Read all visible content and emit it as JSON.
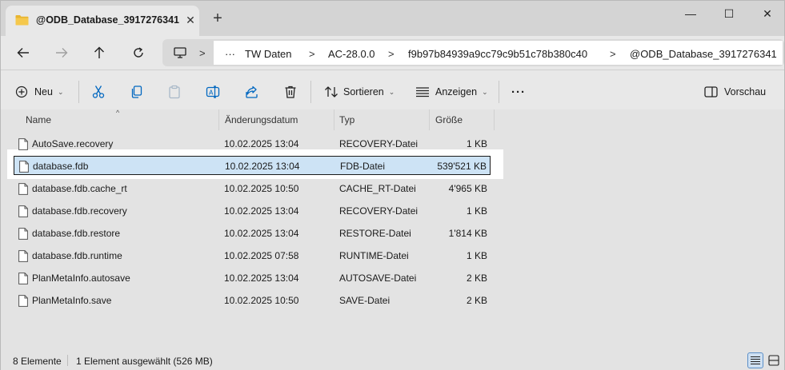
{
  "window": {
    "tab_title": "@ODB_Database_3917276341",
    "close_tab_glyph": "✕",
    "new_tab_glyph": "+",
    "minimize_glyph": "—",
    "maximize_glyph": "☐",
    "close_glyph": "✕"
  },
  "address": {
    "more_glyph": "···",
    "crumbs": [
      "TW Daten",
      "AC-28.0.0",
      "f9b97b84939a9cc79c9b51c78b380c40",
      "@ODB_Database_3917276341"
    ]
  },
  "toolbar": {
    "new_label": "Neu",
    "sort_label": "Sortieren",
    "view_label": "Anzeigen",
    "more_glyph": "···",
    "preview_label": "Vorschau"
  },
  "columns": {
    "name": "Name",
    "date": "Änderungsdatum",
    "type": "Typ",
    "size": "Größe"
  },
  "files": [
    {
      "name": "AutoSave.recovery",
      "date": "10.02.2025 13:04",
      "type": "RECOVERY-Datei",
      "size": "1 KB"
    },
    {
      "name": "database.fdb",
      "date": "10.02.2025 13:04",
      "type": "FDB-Datei",
      "size": "539'521 KB"
    },
    {
      "name": "database.fdb.cache_rt",
      "date": "10.02.2025 10:50",
      "type": "CACHE_RT-Datei",
      "size": "4'965 KB"
    },
    {
      "name": "database.fdb.recovery",
      "date": "10.02.2025 13:04",
      "type": "RECOVERY-Datei",
      "size": "1 KB"
    },
    {
      "name": "database.fdb.restore",
      "date": "10.02.2025 13:04",
      "type": "RESTORE-Datei",
      "size": "1'814 KB"
    },
    {
      "name": "database.fdb.runtime",
      "date": "10.02.2025 07:58",
      "type": "RUNTIME-Datei",
      "size": "1 KB"
    },
    {
      "name": "PlanMetaInfo.autosave",
      "date": "10.02.2025 13:04",
      "type": "AUTOSAVE-Datei",
      "size": "2 KB"
    },
    {
      "name": "PlanMetaInfo.save",
      "date": "10.02.2025 10:50",
      "type": "SAVE-Datei",
      "size": "2 KB"
    }
  ],
  "status": {
    "count": "8 Elemente",
    "selection": "1 Element ausgewählt (526 MB)"
  },
  "colors": {
    "accent": "#0067c0",
    "selection_bg": "#cde3f5",
    "folder": "#e8b531"
  }
}
